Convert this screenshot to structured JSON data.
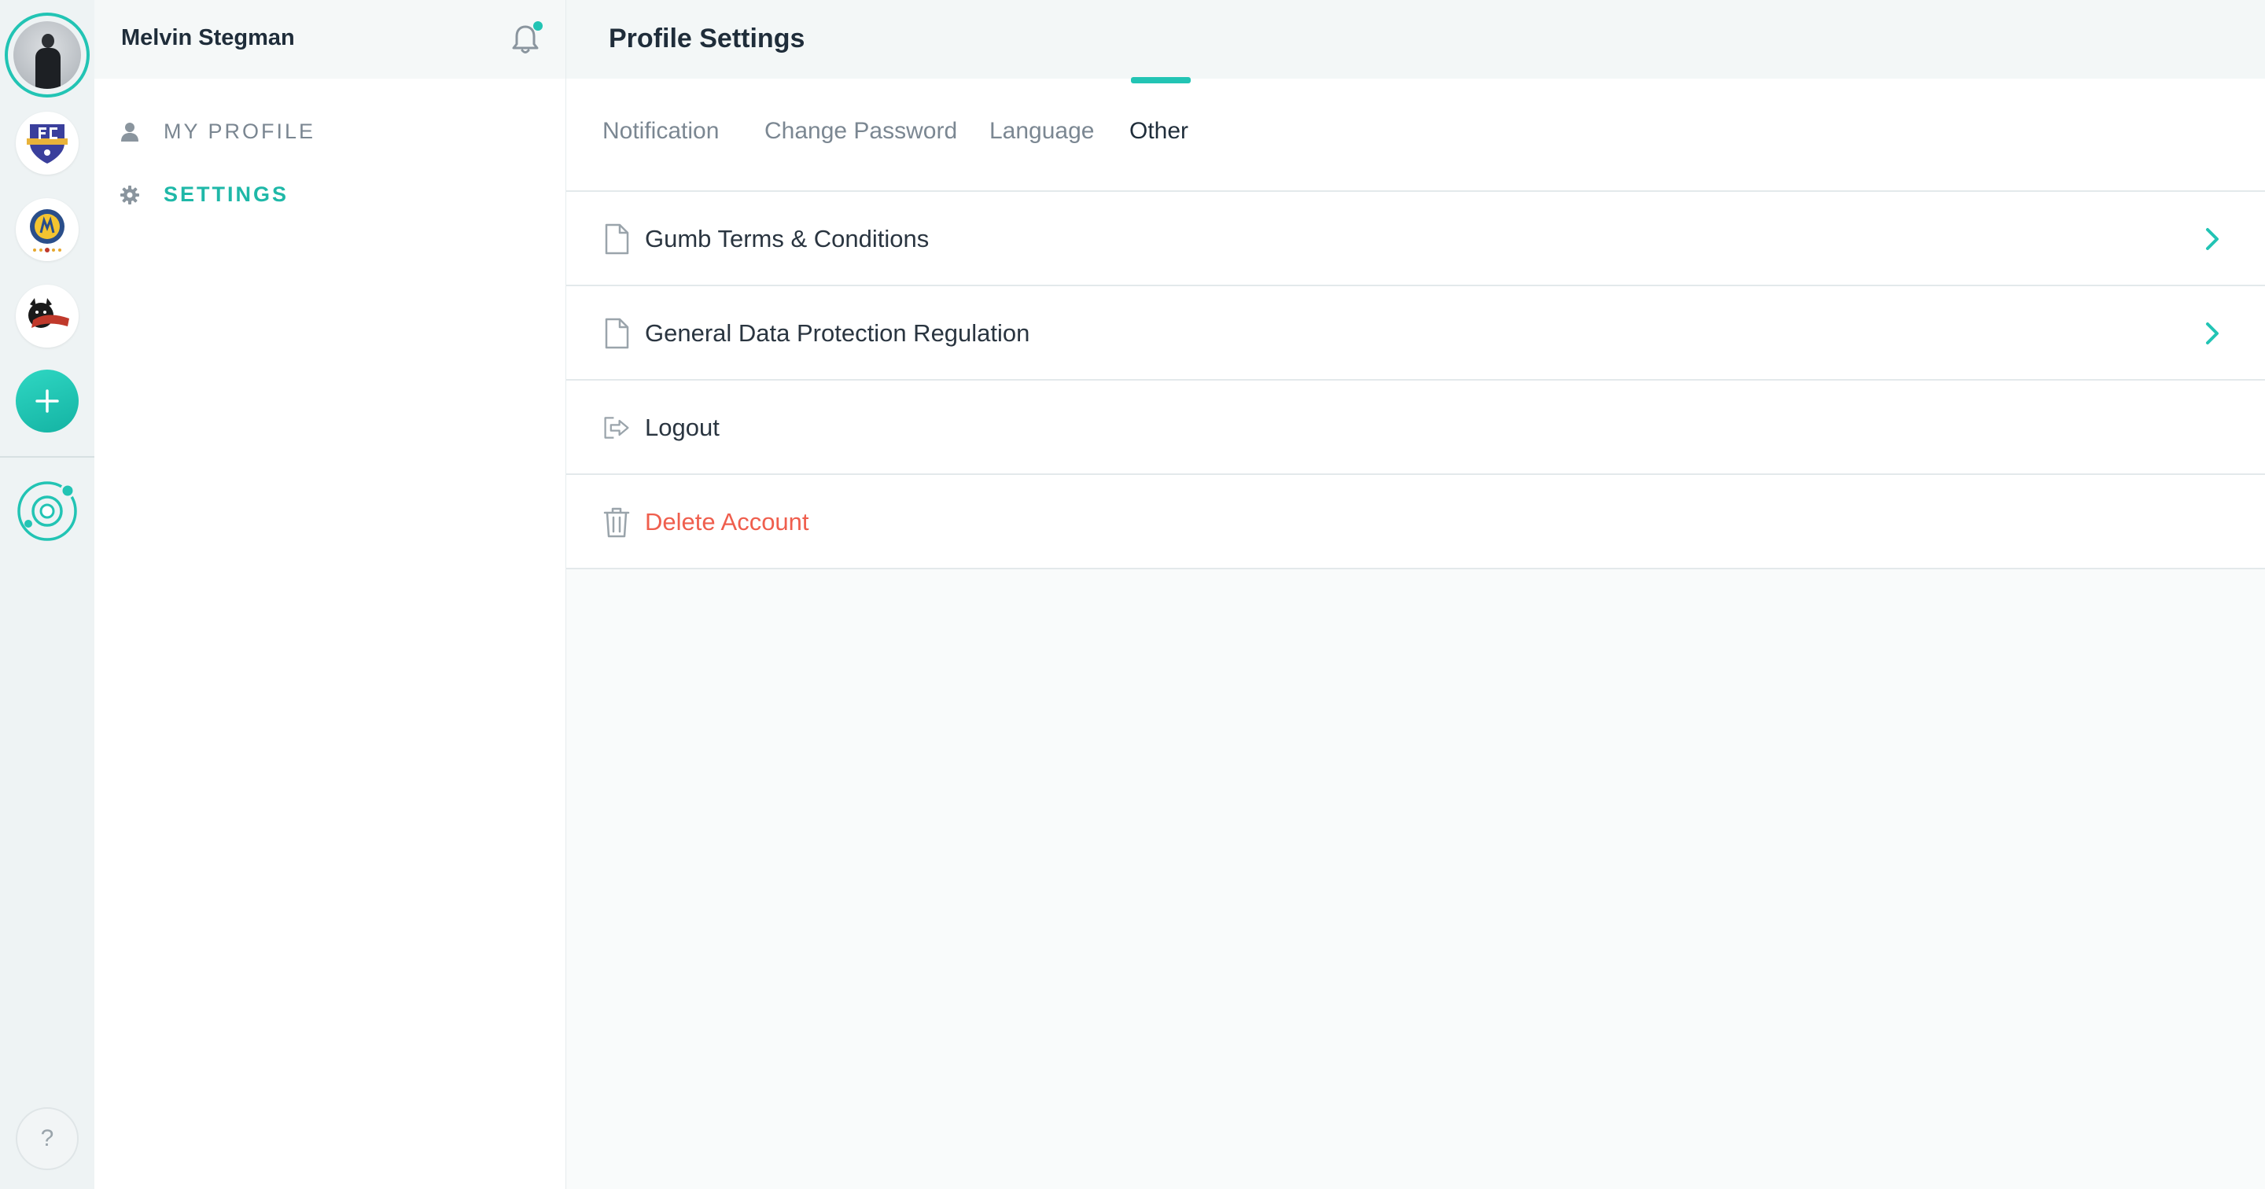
{
  "user": {
    "name": "Melvin Stegman"
  },
  "sidebar": {
    "items": [
      {
        "label": "MY PROFILE",
        "icon": "person-icon",
        "active": false
      },
      {
        "label": "SETTINGS",
        "icon": "gear-icon",
        "active": true
      }
    ]
  },
  "header": {
    "title": "Profile Settings"
  },
  "tabs": [
    {
      "label": "Notification",
      "active": false
    },
    {
      "label": "Change Password",
      "active": false
    },
    {
      "label": "Language",
      "active": false
    },
    {
      "label": "Other",
      "active": true
    }
  ],
  "other_items": [
    {
      "label": "Gumb Terms & Conditions",
      "icon": "document-icon",
      "has_chevron": true
    },
    {
      "label": "General Data Protection Regulation",
      "icon": "document-icon",
      "has_chevron": true
    },
    {
      "label": "Logout",
      "icon": "logout-icon",
      "has_chevron": false
    },
    {
      "label": "Delete Account",
      "icon": "trash-icon",
      "has_chevron": false,
      "danger": true
    }
  ],
  "help": {
    "label": "?"
  },
  "colors": {
    "accent": "#22c4b4",
    "danger": "#ef5e4d",
    "text_dark": "#1f2d3a",
    "text_muted": "#7b8792"
  }
}
